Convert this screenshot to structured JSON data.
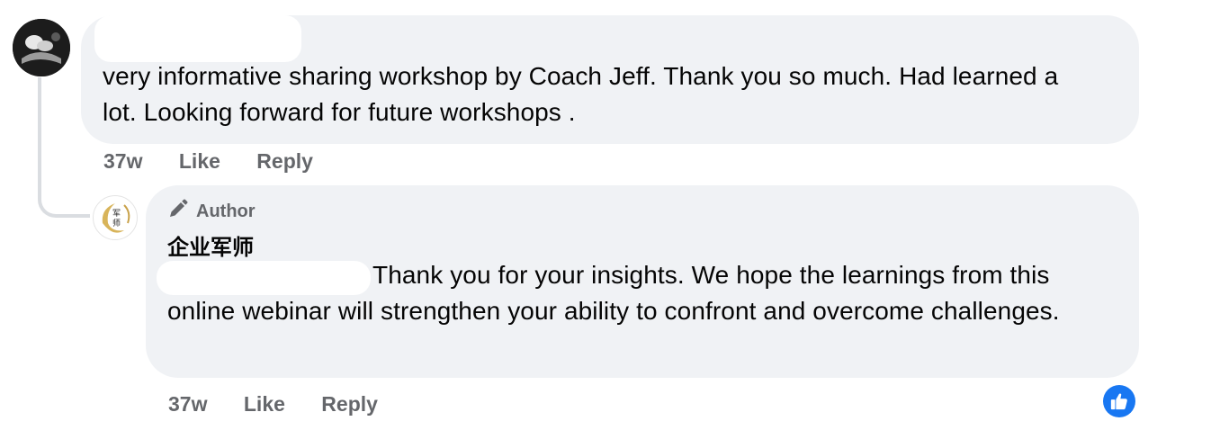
{
  "comment": {
    "text": "very informative sharing workshop by Coach Jeff. Thank you so much. Had learned a lot. Looking forward for future workshops .",
    "actions": {
      "time": "37w",
      "like": "Like",
      "reply": "Reply"
    },
    "avatar_icon": "commenter-avatar"
  },
  "reply": {
    "badge": "Author",
    "badge_icon": "pencil-icon",
    "author_name": "企业军师",
    "text": "Thank you for your insights. We hope the learnings from this online webinar will strengthen your ability to confront and overcome challenges.",
    "actions": {
      "time": "37w",
      "like": "Like",
      "reply": "Reply"
    },
    "avatar_icon": "page-logo-avatar",
    "reaction_icon": "like-thumb-icon"
  },
  "colors": {
    "bubble": "#f0f2f5",
    "meta_text": "#65676b",
    "like_blue": "#1877f2",
    "thread_line": "#dadde1"
  }
}
